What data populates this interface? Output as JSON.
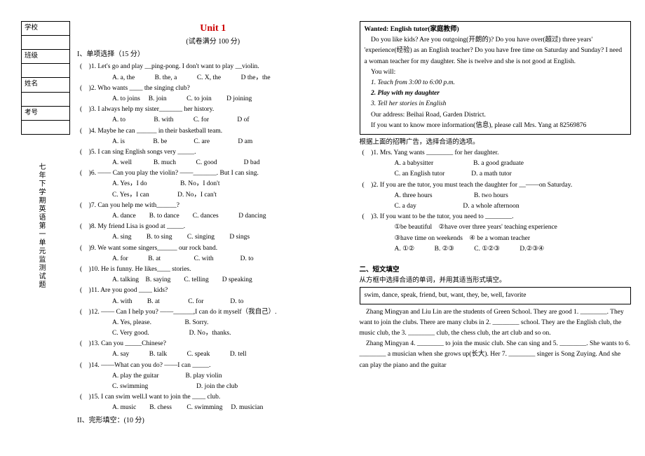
{
  "info_labels": [
    "学校",
    "班级",
    "姓名",
    "考号"
  ],
  "vert_title": "七年下学期英语第一单元监测试题",
  "title": "Unit 1",
  "subtitle": "(试卷满分 100 分)",
  "s1_head": "I、单项选择（15 分）",
  "q1": "(　)1. Let's go and play __ping-pong. I don't want to play __violin.",
  "q1o": "A. a, the　　　B. the, a　　　C. X, the　　　D the，the",
  "q2": "(　)2. Who wants ____ the singing club?",
  "q2o": "A. to joins　 B. join　　　C. to join　　 D joining",
  "q3": "(　)3. I always help my sister_______ her history.",
  "q3o": "A. to　　　　 B. with　　　C. for　　　　 D of",
  "q4": "(　)4. Maybe he can ______ in their basketball team.",
  "q4o": "A. is　　　　 B. be　　　　C. are　　　　 D am",
  "q5": "(　)5. I can sing English songs very _____.",
  "q5o": "A. well　　　 B. much　　　C. good　　　　D bad",
  "q6": "(　)6. —— Can you play the violin? ——_______. But I can sing.",
  "q6o1": "A. Yes，I do　　　　　B. No，I don't",
  "q6o2": "C. Yes，I can　　　　 D. No，I can't",
  "q7": "(　)7. Can you help me with______?",
  "q7o": "A. dance　　B. to dance　　C. dances　　　D dancing",
  "q8": "(　)8. My friend Lisa is good at _____.",
  "q8o": "A. sing　　 B. to sing　　 C. singing　　 D sings",
  "q9": "(　)9. We want some singers______ our rock band.",
  "q9o": "A. for　　　B. at　　　　　C. with　　　　D. to",
  "q10": "(　)10. He is funny. He likes____ stories.",
  "q10o": "A. talking　B. saying　　C. telling　　D speaking",
  "q11": "(　)11. Are you good ____ kids?",
  "q11o": "A. with　　 B. at　　　　 C. for　　　　D. to",
  "q12": "(　)12. —— Can I help you? ——______,I can do it myself（我自己）.",
  "q12o1": "A. Yes, please.　　　　　B. Sorry.",
  "q12o2": "C. Very good.　　　　　　D. No，thanks.",
  "q13": "(　)13. Can you _____Chinese?",
  "q13o": "A. say　　　B. talk　　　C. speak　　　D. tell",
  "q14": "(　)14. ——What can you do? ——I can _____.",
  "q14o1": "A. play the guitar　　　　B. play violin",
  "q14o2": "C. swimming　　　　　　　 D. join the club",
  "q15": "(　)15. I can swim well.I want to join the ____ club.",
  "q15o": "A. music　　B. chess　　 C. swimming　 D. musician",
  "s2_head": "II、完形填空：(10 分)",
  "ad_title": "Wanted: English tutor(家庭教师)",
  "ad_p1": "　Do you like kids? Are you outgoing(开朗的)? Do you have over(超过) three years' 'experience(经验) as an English teacher? Do you have free time on Saturday and Sunday? I need a woman teacher for my daughter. She is twelve and she is not good at English.",
  "ad_p2": "　You will:",
  "ad_l1": "　1. Teach from 3:00 to 6:00 p.m.",
  "ad_l2": "　2. Play with my daughter",
  "ad_l3": "　3. Tell her stories in English",
  "ad_p3": "　Our address: Beihai Road, Garden District.",
  "ad_p4": "　If you want to know more information(信息), please call Mrs. Yang at 82569876",
  "ad_inst": "根据上面的招聘广告，选择合适的选项。",
  "aq1": "(　)1. Mrs. Yang wants ________ for her daughter.",
  "aq1o1": "A. a babysitter　　　　　　B. a good graduate",
  "aq1o2": "C. an English tutor　　　　D. a math tutor",
  "aq2": "(　)2. If you are the tutor, you must teach the daughter for __——on Saturday.",
  "aq2o1": "A. three hours　　　　　　 B. two hours",
  "aq2o2": "C. a day　　　　　　　D. a whole afternoon",
  "aq3": "(　)3. If you want to be the tutor, you need to ________.",
  "aq3a": "①be beautiful　②have over three years' teaching experience",
  "aq3b": "③have time on weekends　④ be a woman teacher",
  "aq3o": "A. ①②　　　B. ②③　　　C. ①②③　　　D.②③④",
  "s3_head": "二、短文填空",
  "s3_inst": "从方框中选择合适的单词，并用其适当形式填空。",
  "wordbox": "swim, dance, speak, friend, but, want, they, be, well, favorite",
  "pass_p1": "　Zhang Mingyan and Liu Lin are the students of Green School. They are good 1. ________. They want to join the clubs. There are many clubs in 2. ________ school. They are the English club, the music club, the 3. ________ club, the chess club, the art club and so on.",
  "pass_p2": "　Zhang Mingyan 4. ________ to join the music club. She can sing and 5. ________. She wants to 6. ________ a musician when she grows up(长大). Her 7. ________ singer is Song Zuying. And she can play the piano and the guitar"
}
